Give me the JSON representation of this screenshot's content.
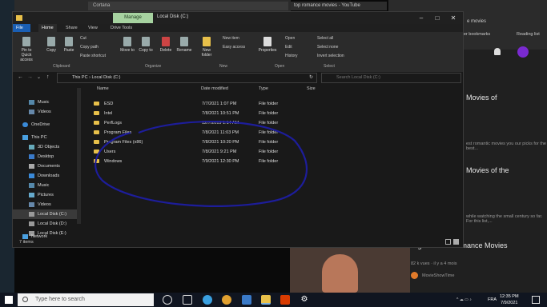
{
  "background": {
    "left_tab": "Cortana",
    "youtube_tab": "top romance movies - YouTube",
    "bookmarks": "Other bookmarks",
    "reading_list": "Reading list",
    "search_hint": "e movies",
    "result1_title": "Movies of",
    "result1_desc": "est romantic movies you our picks for the best...",
    "result2_title": "Movies of the",
    "result3_desc": "while watching the small century so far. For this list,...",
    "result4_title": "High School Romance Movies",
    "result4_meta": "82 k vues · il y a 4 mois",
    "result4_channel": "MovieShowTime"
  },
  "explorer": {
    "manage": "Manage",
    "title": "Local Disk (C:)",
    "menu": [
      "File",
      "Home",
      "Share",
      "View",
      "Drive Tools"
    ],
    "ribbon": {
      "pin": "Pin to Quick access",
      "copy": "Copy",
      "paste": "Paste",
      "cut": "Cut",
      "copy_path": "Copy path",
      "paste_shortcut": "Paste shortcut",
      "move_to": "Move to",
      "copy_to": "Copy to",
      "delete": "Delete",
      "rename": "Rename",
      "new_folder": "New folder",
      "new_item": "New item",
      "easy_access": "Easy access",
      "properties": "Properties",
      "open": "Open",
      "edit": "Edit",
      "history": "History",
      "select_all": "Select all",
      "select_none": "Select none",
      "invert_selection": "Invert selection",
      "groups": [
        "Clipboard",
        "Organize",
        "New",
        "Open",
        "Select"
      ]
    },
    "address": "This PC  ›  Local Disk (C:)",
    "search_placeholder": "Search Local Disk (C:)",
    "nav": [
      "Music",
      "Videos",
      "OneDrive",
      "This PC",
      "3D Objects",
      "Desktop",
      "Documents",
      "Downloads",
      "Music",
      "Pictures",
      "Videos",
      "Local Disk (C:)",
      "Local Disk (D:)",
      "Local Disk (E:)",
      "Network"
    ],
    "columns": [
      "Name",
      "Date modified",
      "Type",
      "Size"
    ],
    "files": [
      {
        "name": "ESD",
        "date": "7/7/2021 1:07 PM",
        "type": "File folder"
      },
      {
        "name": "Intel",
        "date": "7/8/2021 10:51 PM",
        "type": "File folder"
      },
      {
        "name": "PerfLogs",
        "date": "12/7/2019 1:14 AM",
        "type": "File folder"
      },
      {
        "name": "Program Files",
        "date": "7/8/2021 11:03 PM",
        "type": "File folder"
      },
      {
        "name": "Program Files (x86)",
        "date": "7/8/2021 10:20 PM",
        "type": "File folder"
      },
      {
        "name": "Users",
        "date": "7/8/2021 9:21 PM",
        "type": "File folder"
      },
      {
        "name": "Windows",
        "date": "7/9/2021 12:30 PM",
        "type": "File folder"
      }
    ],
    "status": "7 items"
  },
  "taskbar": {
    "search": "Type here to search",
    "lang": "FRA",
    "time": "12:35 PM",
    "date": "7/9/2021"
  },
  "colors": {
    "accent": "#1a5fb4",
    "manage": "#a6d2a0",
    "folder": "#e8c04a",
    "annotation": "#1d1d9a"
  }
}
